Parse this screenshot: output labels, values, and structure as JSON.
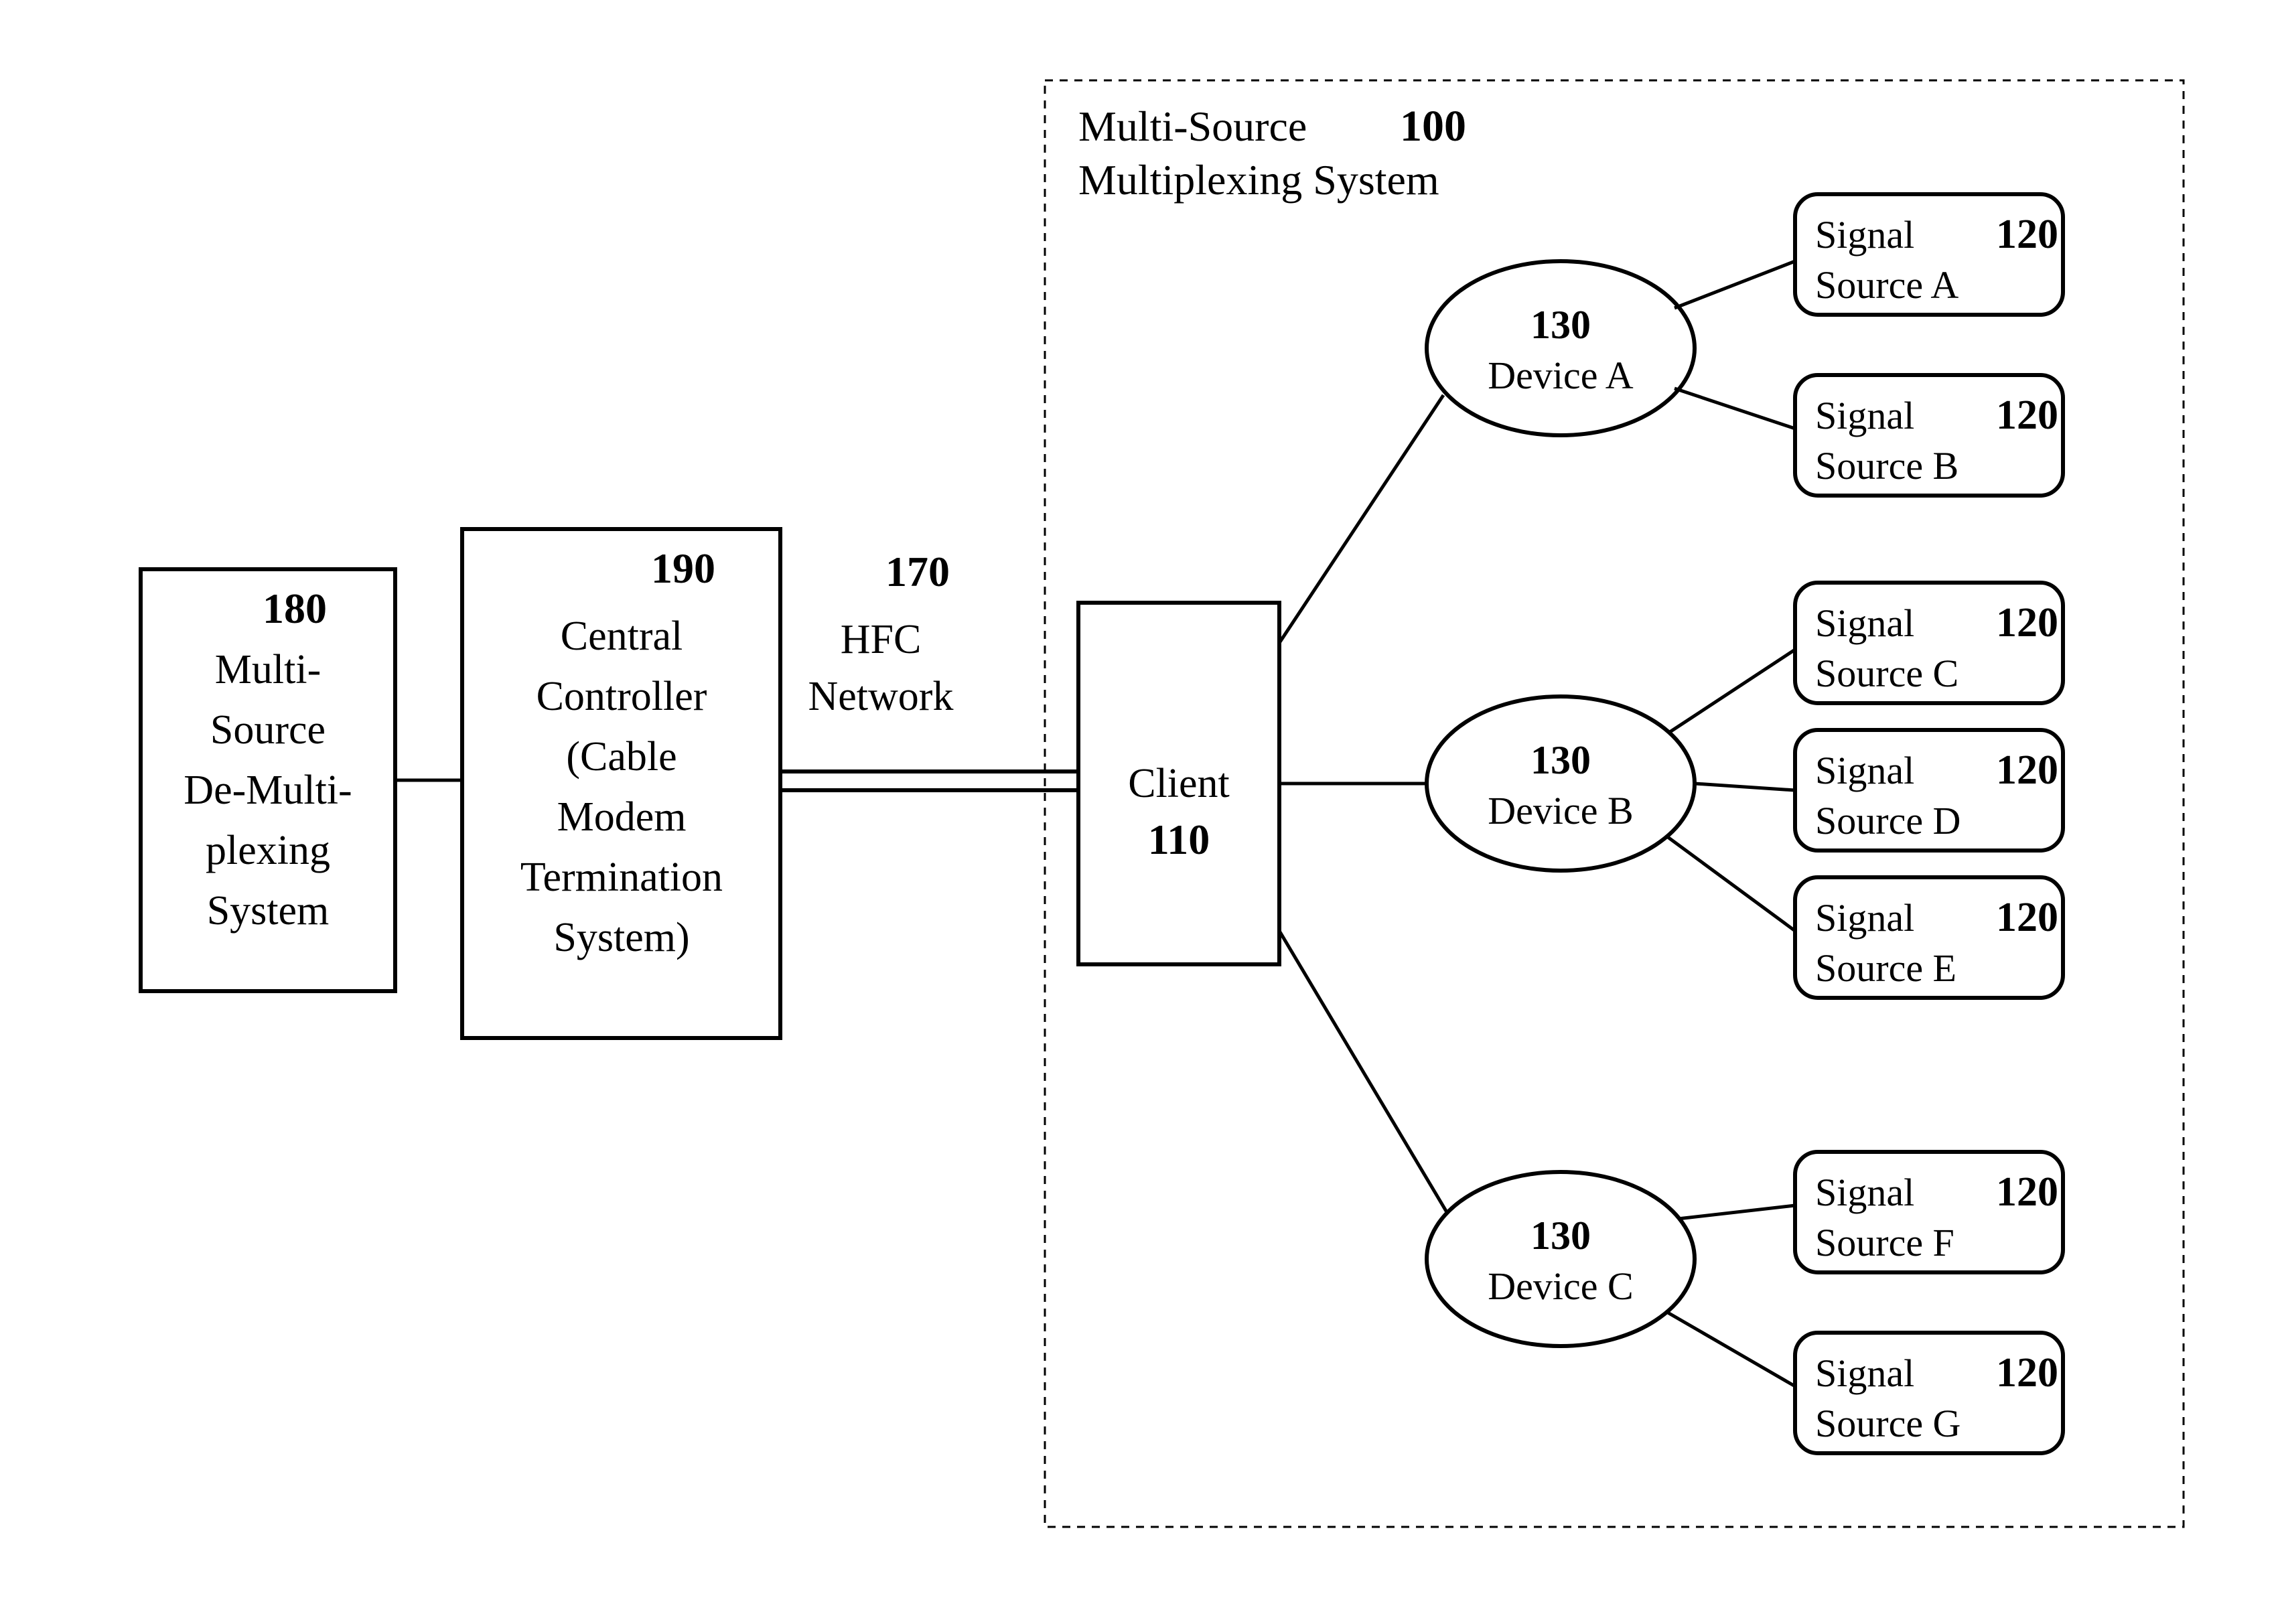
{
  "system_box": {
    "title_l1": "Multi-Source",
    "title_l2": "Multiplexing System",
    "num": "100"
  },
  "demux": {
    "num": "180",
    "l1": "Multi-",
    "l2": "Source",
    "l3": "De-Multi-",
    "l4": "plexing",
    "l5": "System"
  },
  "controller": {
    "num": "190",
    "l1": "Central",
    "l2": "Controller",
    "l3": "(Cable",
    "l4": "Modem",
    "l5": "Termination",
    "l6": "System)"
  },
  "hfc": {
    "num": "170",
    "l1": "HFC",
    "l2": "Network"
  },
  "client": {
    "num": "110",
    "label": "Client"
  },
  "devices": {
    "a": {
      "num": "130",
      "label": "Device A"
    },
    "b": {
      "num": "130",
      "label": "Device B"
    },
    "c": {
      "num": "130",
      "label": "Device C"
    }
  },
  "sources": {
    "a": {
      "num": "120",
      "l1": "Signal",
      "l2": "Source A"
    },
    "b": {
      "num": "120",
      "l1": "Signal",
      "l2": "Source B"
    },
    "c": {
      "num": "120",
      "l1": "Signal",
      "l2": "Source C"
    },
    "d": {
      "num": "120",
      "l1": "Signal",
      "l2": "Source D"
    },
    "e": {
      "num": "120",
      "l1": "Signal",
      "l2": "Source E"
    },
    "f": {
      "num": "120",
      "l1": "Signal",
      "l2": "Source F"
    },
    "g": {
      "num": "120",
      "l1": "Signal",
      "l2": "Source G"
    }
  }
}
